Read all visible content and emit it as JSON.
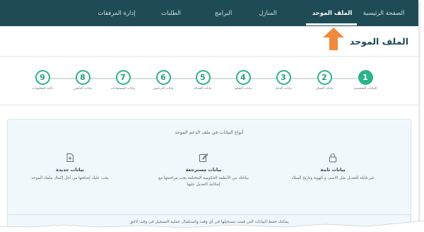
{
  "nav": {
    "items": [
      {
        "label": "الصفحة الرئيسية",
        "active": false
      },
      {
        "label": "الملف الموحد",
        "active": true
      },
      {
        "label": "المنازل",
        "active": false
      },
      {
        "label": "البرامج",
        "active": false
      },
      {
        "label": "الطلبات",
        "active": false
      },
      {
        "label": "إدارة المرفقات",
        "active": false
      }
    ]
  },
  "page": {
    "title": "الملف الموحد"
  },
  "steps": [
    {
      "number": "1",
      "label": "البيانات الشخصية",
      "active": true
    },
    {
      "number": "2",
      "label": "بيانات السكن",
      "active": false
    },
    {
      "number": "3",
      "label": "بيانات الدخل",
      "active": false
    },
    {
      "number": "4",
      "label": "بيانات التعليم",
      "active": false
    },
    {
      "number": "5",
      "label": "بيانات العمالة",
      "active": false
    },
    {
      "number": "6",
      "label": "بيانات الترخيص",
      "active": false
    },
    {
      "number": "7",
      "label": "بيانات المستفادات",
      "active": false
    },
    {
      "number": "8",
      "label": "بيانات التابعين",
      "active": false
    },
    {
      "number": "9",
      "label": "تأكيد المعلومات",
      "active": false
    }
  ],
  "info": {
    "title": "أنواع البيانات في ملف الدعم الموحد",
    "columns": [
      {
        "icon": "lock-icon",
        "heading": "بيانات ثابتة",
        "desc1": "غير قابلة للتعديل مثل الاسم، و الهوية وتاريخ الميلاد",
        "desc2": ""
      },
      {
        "icon": "edit-icon",
        "heading": "بيانات مسترجعة",
        "desc1": "بياناتك من الأنظمة الحكومية المختلفة يجب مراجعتها مع",
        "desc2": "إمكانية التعديل عليها"
      },
      {
        "icon": "new-file-icon",
        "heading": "بيانات جديدة",
        "desc1": "يجب عليك إضافتها من أجل إكمال ملفك الموحد",
        "desc2": ""
      }
    ],
    "footer": "يمكنك حفظ البيانات التي قمت بتسجيلها في أي وقت واستكمال عملية التسجيل في وقت لاحق"
  },
  "colors": {
    "nav_bg": "#1f4b57",
    "accent_green": "#2bb38a",
    "arrow_orange": "#f08a3c",
    "panel_bg": "#f1f8fb"
  }
}
